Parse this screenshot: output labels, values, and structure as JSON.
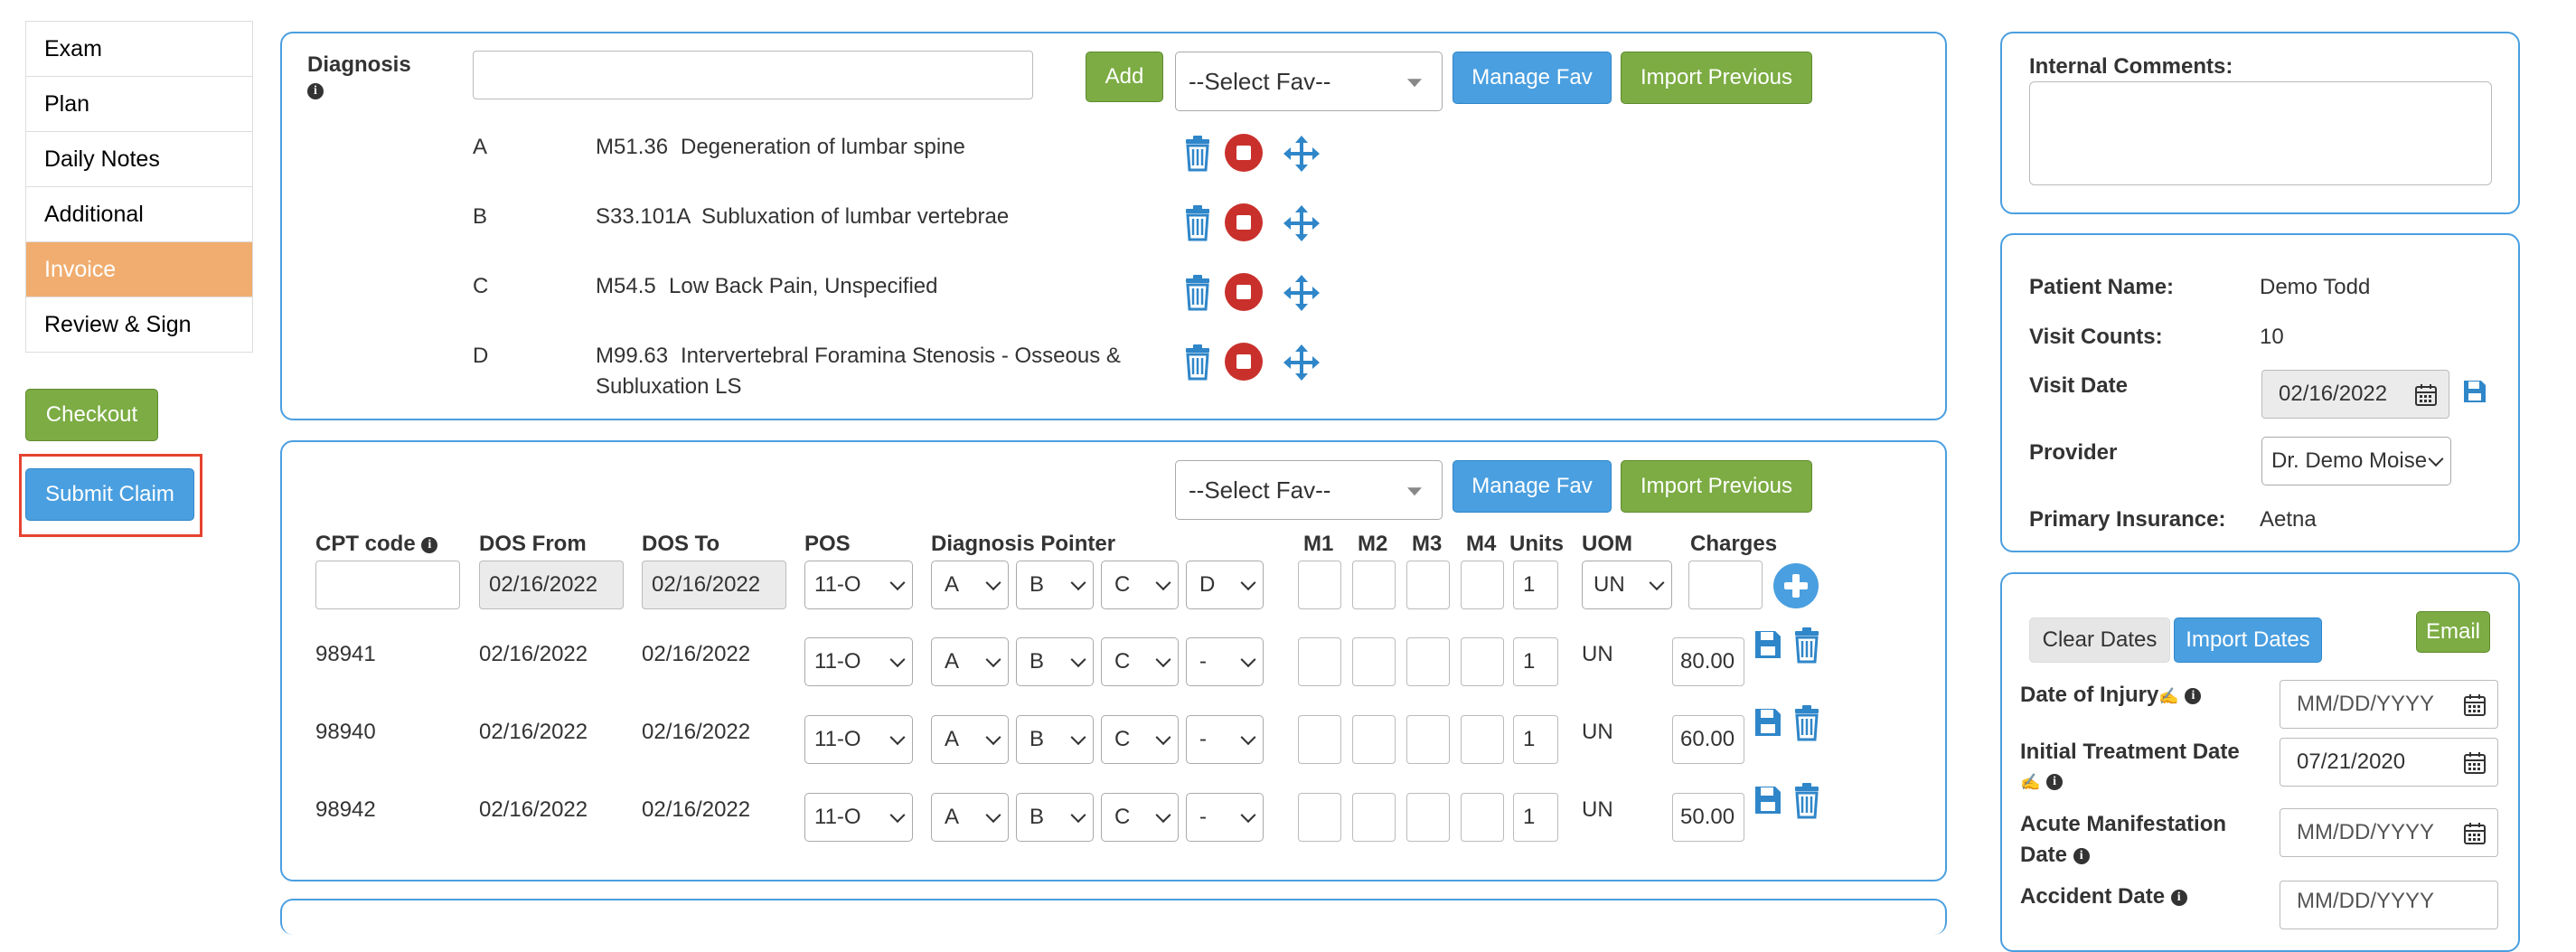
{
  "nav": {
    "items": [
      "Exam",
      "Plan",
      "Daily Notes",
      "Additional",
      "Invoice",
      "Review & Sign"
    ],
    "active": "Invoice"
  },
  "actions": {
    "checkout": "Checkout",
    "submit_claim": "Submit Claim"
  },
  "diagnosis": {
    "label": "Diagnosis",
    "add_button": "Add",
    "select_fav": "--Select Fav--",
    "manage_fav": "Manage Fav",
    "import_previous": "Import Previous",
    "items": [
      {
        "letter": "A",
        "code": "M51.36",
        "desc": "Degeneration of lumbar spine"
      },
      {
        "letter": "B",
        "code": "S33.101A",
        "desc": "Subluxation of lumbar vertebrae"
      },
      {
        "letter": "C",
        "code": "M54.5",
        "desc": "Low Back Pain, Unspecified"
      },
      {
        "letter": "D",
        "code": "M99.63",
        "desc": "Intervertebral Foramina Stenosis - Osseous &",
        "desc2": "Subluxation LS"
      }
    ]
  },
  "cpt": {
    "select_fav": "--Select Fav--",
    "manage_fav": "Manage Fav",
    "import_previous": "Import Previous",
    "headers": {
      "cpt_code": "CPT code",
      "dos_from": "DOS From",
      "dos_to": "DOS To",
      "pos": "POS",
      "dx_pointer": "Diagnosis Pointer",
      "m1": "M1",
      "m2": "M2",
      "m3": "M3",
      "m4": "M4",
      "units": "Units",
      "uom": "UOM",
      "charges": "Charges"
    },
    "new_row": {
      "dos_from": "02/16/2022",
      "dos_to": "02/16/2022",
      "pos": "11-O",
      "pointers": [
        "A",
        "B",
        "C",
        "D"
      ],
      "units": "1",
      "uom": "UN"
    },
    "rows": [
      {
        "code": "98941",
        "dos_from": "02/16/2022",
        "dos_to": "02/16/2022",
        "pos": "11-O",
        "pointers": [
          "A",
          "B",
          "C",
          "-"
        ],
        "units": "1",
        "uom": "UN",
        "charges": "80.00"
      },
      {
        "code": "98940",
        "dos_from": "02/16/2022",
        "dos_to": "02/16/2022",
        "pos": "11-O",
        "pointers": [
          "A",
          "B",
          "C",
          "-"
        ],
        "units": "1",
        "uom": "UN",
        "charges": "60.00"
      },
      {
        "code": "98942",
        "dos_from": "02/16/2022",
        "dos_to": "02/16/2022",
        "pos": "11-O",
        "pointers": [
          "A",
          "B",
          "C",
          "-"
        ],
        "units": "1",
        "uom": "UN",
        "charges": "50.00"
      }
    ]
  },
  "comments": {
    "label": "Internal Comments:"
  },
  "patient": {
    "name_label": "Patient Name:",
    "name": "Demo Todd",
    "visit_counts_label": "Visit Counts:",
    "visit_counts": "10",
    "visit_date_label": "Visit Date",
    "visit_date": "02/16/2022",
    "provider_label": "Provider",
    "provider": "Dr. Demo Moise",
    "insurance_label": "Primary Insurance:",
    "insurance": "Aetna"
  },
  "dates": {
    "clear_dates": "Clear Dates",
    "import_dates": "Import Dates",
    "email": "Email",
    "injury_label": "Date of Injury",
    "injury_placeholder": "MM/DD/YYYY",
    "initial_label_1": "Initial Treatment Date",
    "initial_value": "07/21/2020",
    "acute_label_1": "Acute Manifestation",
    "acute_label_2": "Date",
    "acute_placeholder": "MM/DD/YYYY",
    "accident_label": "Accident Date",
    "accident_placeholder": "MM/DD/YYYY"
  },
  "colors": {
    "accent_blue": "#4a9fe0",
    "green": "#7cac43",
    "active_tab": "#f0ad6f",
    "highlight": "#e5432f",
    "danger": "#c9302c"
  }
}
